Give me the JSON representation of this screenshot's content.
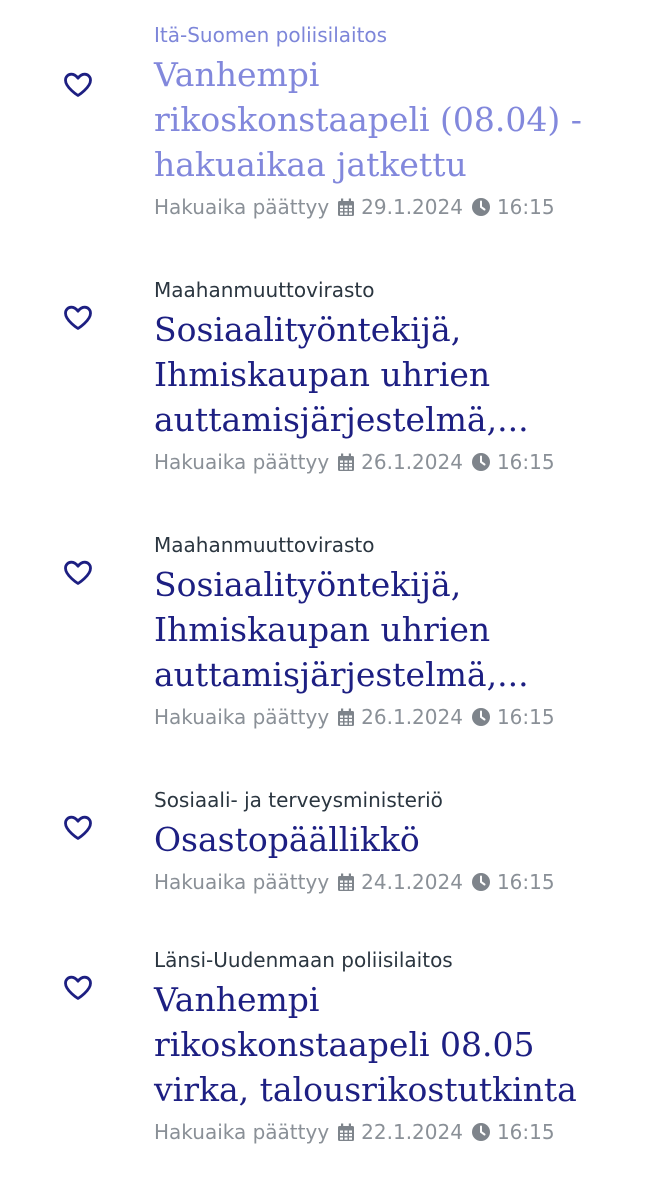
{
  "colors": {
    "heart": "#1d1f82",
    "title": "#1d1f82",
    "title_visited": "#8288dc",
    "meta": "#8a9097",
    "icon": "#7e848b"
  },
  "jobs": [
    {
      "organization": "Itä-Suomen poliisilaitos",
      "title_lines": [
        "Vanhempi",
        "rikoskonstaapeli (08.04) -",
        "hakuaikaa jatkettu"
      ],
      "deadline_label": "Hakuaika päättyy",
      "date": "29.1.2024",
      "time": "16:15",
      "visited": true,
      "icon": "heart-outline-icon"
    },
    {
      "organization": "Maahanmuuttovirasto",
      "title_lines": [
        "Sosiaalityöntekijä,",
        "Ihmiskaupan uhrien",
        "auttamisjärjestelmä,..."
      ],
      "deadline_label": "Hakuaika päättyy",
      "date": "26.1.2024",
      "time": "16:15",
      "visited": false,
      "icon": "heart-outline-icon"
    },
    {
      "organization": "Maahanmuuttovirasto",
      "title_lines": [
        "Sosiaalityöntekijä,",
        "Ihmiskaupan uhrien",
        "auttamisjärjestelmä,..."
      ],
      "deadline_label": "Hakuaika päättyy",
      "date": "26.1.2024",
      "time": "16:15",
      "visited": false,
      "icon": "heart-outline-icon"
    },
    {
      "organization": "Sosiaali- ja terveysministeriö",
      "title_lines": [
        "Osastopäällikkö"
      ],
      "deadline_label": "Hakuaika päättyy",
      "date": "24.1.2024",
      "time": "16:15",
      "visited": false,
      "icon": "heart-outline-icon"
    },
    {
      "organization": "Länsi-Uudenmaan poliisilaitos",
      "title_lines": [
        "Vanhempi",
        "rikoskonstaapeli 08.05",
        "virka, talousrikostutkinta"
      ],
      "deadline_label": "Hakuaika päättyy",
      "date": "22.1.2024",
      "time": "16:15",
      "visited": false,
      "icon": "heart-outline-icon"
    }
  ]
}
